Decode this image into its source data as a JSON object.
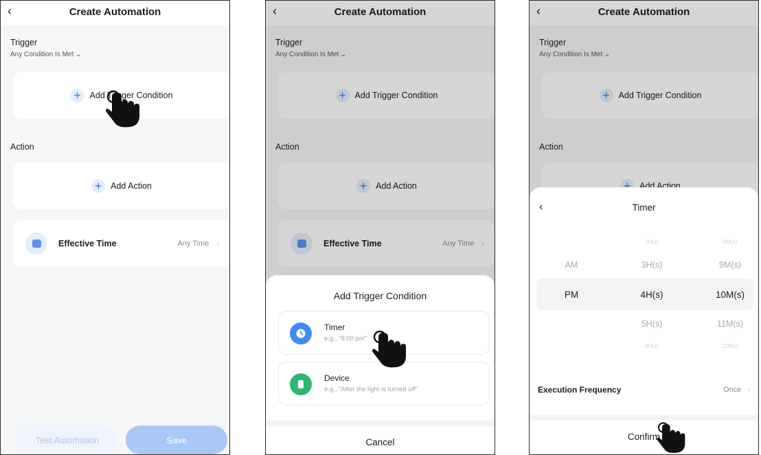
{
  "screen1": {
    "back_icon": "chevron-left-icon",
    "title": "Create Automation",
    "trigger_label": "Trigger",
    "trigger_mode": "Any Condition Is Met",
    "add_trigger": "Add Trigger Condition",
    "action_label": "Action",
    "add_action": "Add Action",
    "effective_time_label": "Effective Time",
    "effective_time_value": "Any Time",
    "test_button": "Test Automation",
    "save_button": "Save"
  },
  "screen2": {
    "title": "Create Automation",
    "trigger_label": "Trigger",
    "trigger_mode": "Any Condition Is Met",
    "add_trigger": "Add Trigger Condition",
    "action_label": "Action",
    "add_action": "Add Action",
    "effective_time_label": "Effective Time",
    "effective_time_value": "Any Time",
    "sheet_title": "Add Trigger Condition",
    "options": [
      {
        "name": "Timer",
        "desc": "e.g., \"8:00 pm\"",
        "icon": "clock-icon",
        "color": "#3f8cf0"
      },
      {
        "name": "Device",
        "desc": "e.g., \"After the light is turned off\"",
        "icon": "device-icon",
        "color": "#2bb673"
      }
    ],
    "cancel": "Cancel"
  },
  "screen3": {
    "title": "Create Automation",
    "trigger_label": "Trigger",
    "trigger_mode": "Any Condition Is Met",
    "add_trigger": "Add Trigger Condition",
    "action_label": "Action",
    "add_action": "Add Action",
    "timer_title": "Timer",
    "ampm": [
      "AM",
      "PM"
    ],
    "hours": [
      "2H(s)",
      "3H(s)",
      "4H(s)",
      "5H(s)",
      "6H(s)"
    ],
    "minutes": [
      "8M(s)",
      "9M(s)",
      "10M(s)",
      "11M(s)",
      "12M(s)"
    ],
    "frequency_label": "Execution Frequency",
    "frequency_value": "Once",
    "confirm": "Confirm"
  },
  "colors": {
    "accent": "#3b7ff0",
    "page_bg": "#f5f6f8"
  }
}
